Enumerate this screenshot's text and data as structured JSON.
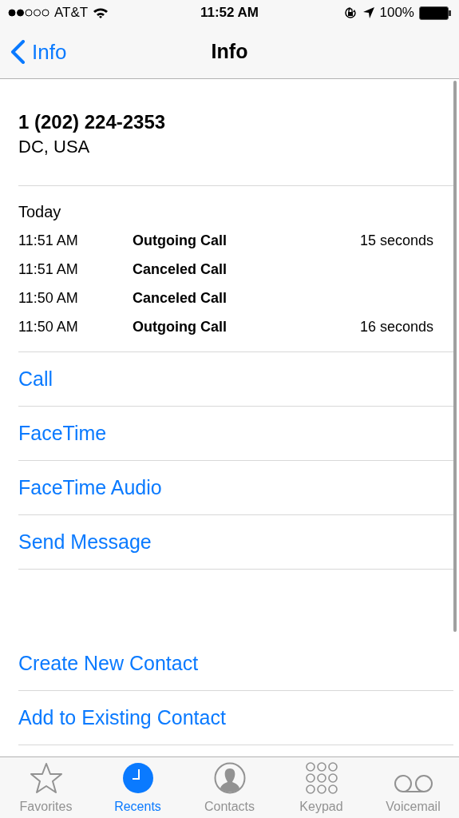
{
  "status_bar": {
    "carrier": "AT&T",
    "time": "11:52 AM",
    "battery": "100%"
  },
  "nav": {
    "back": "Info",
    "title": "Info"
  },
  "contact": {
    "number": "1 (202) 224-2353",
    "location": "DC, USA"
  },
  "history": {
    "heading": "Today",
    "calls": [
      {
        "time": "11:51 AM",
        "type": "Outgoing Call",
        "duration": "15 seconds"
      },
      {
        "time": "11:51 AM",
        "type": "Canceled Call"
      },
      {
        "time": "11:50 AM",
        "type": "Canceled Call"
      },
      {
        "time": "11:50 AM",
        "type": "Outgoing Call",
        "duration": "16 seconds"
      }
    ]
  },
  "actions": [
    "Call",
    "FaceTime",
    "FaceTime Audio",
    "Send Message"
  ],
  "contact_actions": [
    "Create New Contact",
    "Add to Existing Contact"
  ],
  "tab_bar": [
    {
      "kind": "favorites",
      "label": "Favorites",
      "selected": false
    },
    {
      "kind": "recents",
      "label": "Recents",
      "selected": true
    },
    {
      "kind": "contacts",
      "label": "Contacts",
      "selected": false
    },
    {
      "kind": "keypad",
      "label": "Keypad",
      "selected": false
    },
    {
      "kind": "voicemail",
      "label": "Voicemail",
      "selected": false
    }
  ]
}
